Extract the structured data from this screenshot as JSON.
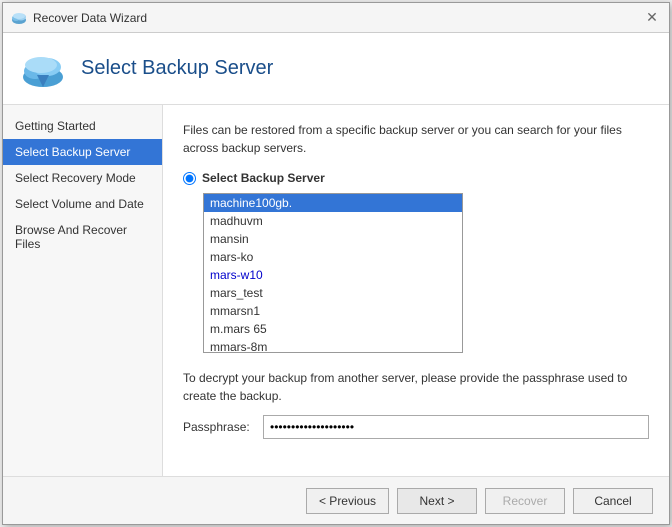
{
  "window": {
    "title": "Recover Data Wizard",
    "close_label": "✕"
  },
  "header": {
    "title": "Select Backup Server"
  },
  "sidebar": {
    "items": [
      {
        "id": "getting-started",
        "label": "Getting Started",
        "active": false
      },
      {
        "id": "select-backup-server",
        "label": "Select Backup Server",
        "active": true
      },
      {
        "id": "select-recovery-mode",
        "label": "Select Recovery Mode",
        "active": false
      },
      {
        "id": "select-volume-date",
        "label": "Select Volume and Date",
        "active": false
      },
      {
        "id": "browse-recover",
        "label": "Browse And Recover Files",
        "active": false
      }
    ]
  },
  "main": {
    "description": "Files can be restored from a specific backup server or you can search for your files across backup servers.",
    "radio_label": "Select Backup Server",
    "servers": [
      {
        "id": "machine100gb",
        "label": "machine100gb.",
        "selected": true
      },
      {
        "id": "madhuvm",
        "label": "madhuvm",
        "selected": false
      },
      {
        "id": "mansin",
        "label": "mansin",
        "selected": false
      },
      {
        "id": "mars-ko",
        "label": "mars-ko",
        "selected": false
      },
      {
        "id": "mars-w10",
        "label": "mars-w10",
        "selected": false
      },
      {
        "id": "mars_test",
        "label": "mars_test",
        "selected": false
      },
      {
        "id": "mmarsn1",
        "label": "mmarsn1",
        "selected": false
      },
      {
        "id": "m.mars65",
        "label": "m.mars 65",
        "selected": false
      },
      {
        "id": "mmars-8m",
        "label": "mmars-8m",
        "selected": false
      }
    ],
    "decrypt_text": "To decrypt your backup from another server, please provide the passphrase used to create the backup.",
    "passphrase_label": "Passphrase:",
    "passphrase_value": "••••••••••••••••••••"
  },
  "footer": {
    "previous_label": "< Previous",
    "next_label": "Next >",
    "recover_label": "Recover",
    "cancel_label": "Cancel"
  }
}
